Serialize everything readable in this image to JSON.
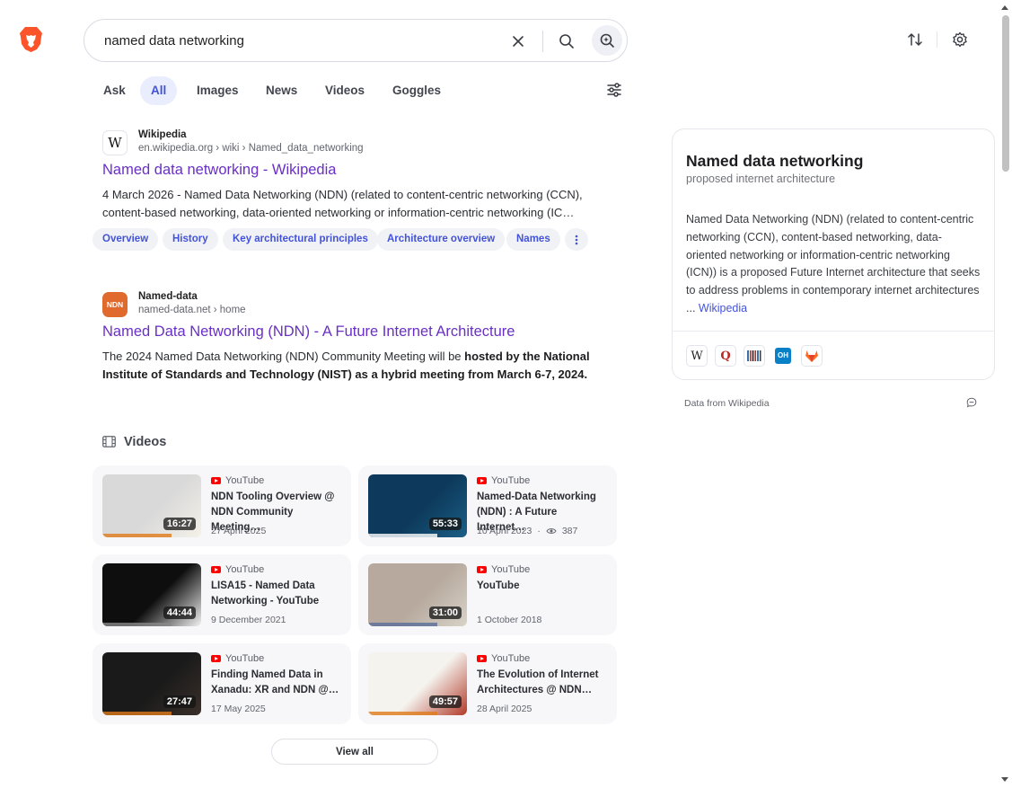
{
  "search": {
    "query": "named data networking"
  },
  "tabs": [
    {
      "label": "Ask"
    },
    {
      "label": "All",
      "active": true
    },
    {
      "label": "Images"
    },
    {
      "label": "News"
    },
    {
      "label": "Videos"
    },
    {
      "label": "Goggles"
    }
  ],
  "results": [
    {
      "site_name": "Wikipedia",
      "url": "en.wikipedia.org › wiki › Named_data_networking",
      "title": "Named data networking - Wikipedia",
      "date": "4 March 2026",
      "snippet": "Named Data Networking (NDN) (related to content-centric networking (CCN), content-based networking, data-oriented networking or information-centric networking (IC…",
      "favicon_text": "W",
      "chips": [
        "Overview",
        "History",
        "Key architectural principles",
        "Architecture overview",
        "Names"
      ]
    },
    {
      "site_name": "Named-data",
      "url": "named-data.net › home",
      "title": "Named Data Networking (NDN) - A Future Internet Architecture",
      "snippet_plain": "The 2024 Named Data Networking (NDN) Community Meeting will be ",
      "snippet_bold": "hosted by the National Institute of Standards and Technology (NIST) as a hybrid meeting from March 6-7, 2024",
      "snippet_end": ".",
      "favicon_text": "NDN"
    }
  ],
  "videos": {
    "heading": "Videos",
    "items": [
      {
        "source": "YouTube",
        "title": "NDN Tooling Overview @ NDN Community Meeting…",
        "date": "27 April 2025",
        "duration": "16:27",
        "thumb_colors": [
          "#d9d9d9",
          "#f4f1e8"
        ],
        "accent": "#e07b1a"
      },
      {
        "source": "YouTube",
        "title": "Named-Data Networking (NDN) : A Future Internet…",
        "date": "10 April 2023",
        "views": "387",
        "duration": "55:33",
        "thumb_colors": [
          "#0d3a5c",
          "#1b5f86"
        ],
        "accent": "#ffffff"
      },
      {
        "source": "YouTube",
        "title": "LISA15 - Named Data Networking - YouTube",
        "date": "9 December 2021",
        "duration": "44:44",
        "thumb_colors": [
          "#0e0e0e",
          "#f2f2f2"
        ],
        "accent": "#888888"
      },
      {
        "source": "YouTube",
        "title": "YouTube",
        "date": "1 October 2018",
        "duration": "31:00",
        "thumb_colors": [
          "#b7a99e",
          "#d8d3c8"
        ],
        "accent": "#5a6e9a"
      },
      {
        "source": "YouTube",
        "title": "Finding Named Data in Xanadu: XR and NDN @…",
        "date": "17 May 2025",
        "duration": "27:47",
        "thumb_colors": [
          "#1a1a1a",
          "#3a2f2a"
        ],
        "accent": "#e07b1a"
      },
      {
        "source": "YouTube",
        "title": "The Evolution of Internet Architectures @ NDN…",
        "date": "28 April 2025",
        "duration": "49:57",
        "thumb_colors": [
          "#f5f3ee",
          "#b23a2a"
        ],
        "accent": "#e07b1a"
      }
    ],
    "view_all": "View all"
  },
  "knowledge_panel": {
    "title": "Named data networking",
    "subtitle": "proposed internet architecture",
    "description": "Named Data Networking (NDN) (related to content-centric networking (CCN), content-based networking, data-oriented networking or information-centric networking (ICN)) is a proposed Future Internet architecture that seeks to address problems in contemporary internet architectures ...",
    "link": "Wikipedia",
    "source_icons": [
      "wikipedia-icon",
      "quora-icon",
      "library-icon",
      "openhub-icon",
      "gitlab-icon"
    ],
    "footer": "Data from Wikipedia"
  },
  "colors": {
    "accent": "#4353d8",
    "title_link": "#6a2fc6",
    "brand": "#fb542b"
  }
}
